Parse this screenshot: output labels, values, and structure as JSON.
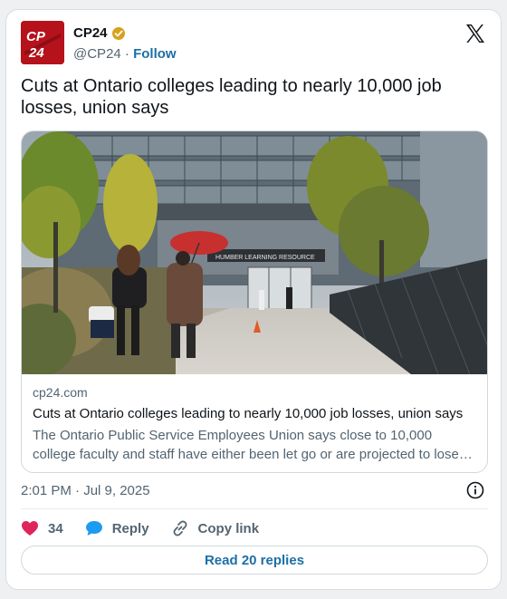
{
  "author": {
    "logo_text": "CP24",
    "name": "CP24",
    "handle": "@CP24",
    "separator": "·",
    "follow_label": "Follow"
  },
  "tweet": {
    "text": "Cuts at Ontario colleges leading to nearly 10,000 job losses, union says"
  },
  "preview": {
    "image_sign": "HUMBER LEARNING RESOURCE",
    "domain": "cp24.com",
    "title": "Cuts at Ontario colleges leading to nearly 10,000 job losses, union says",
    "description": "The Ontario Public Service Employees Union says close to 10,000 college faculty and staff have either been let go or are projected to lose their jobs"
  },
  "meta": {
    "timestamp": "2:01 PM · Jul 9, 2025"
  },
  "actions": {
    "like_count": "34",
    "reply_label": "Reply",
    "copy_label": "Copy link",
    "read_replies_label": "Read 20 replies"
  },
  "colors": {
    "brand_red": "#b5121b",
    "link_blue": "#1d6fa5",
    "heart_pink": "#e0245e",
    "reply_blue": "#1d9bf0",
    "verified_gold": "#d6a21e"
  }
}
